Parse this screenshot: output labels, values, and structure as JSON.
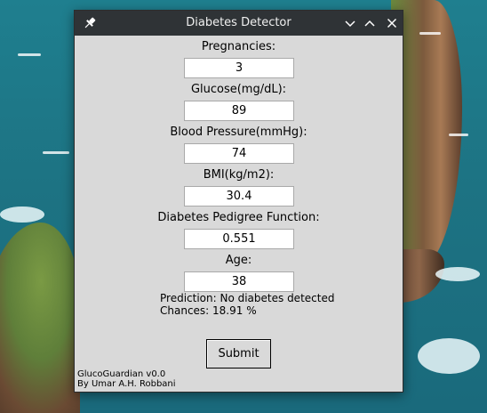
{
  "window": {
    "title": "Diabetes Detector",
    "controls": [
      "pin-icon",
      "chevron-down-icon",
      "chevron-up-icon",
      "close-icon"
    ]
  },
  "form": {
    "fields": [
      {
        "label": "Pregnancies:",
        "value": "3"
      },
      {
        "label": "Glucose(mg/dL):",
        "value": "89"
      },
      {
        "label": "Blood Pressure(mmHg):",
        "value": "74"
      },
      {
        "label": "BMI(kg/m2):",
        "value": "30.4"
      },
      {
        "label": "Diabetes Pedigree Function:",
        "value": "0.551"
      },
      {
        "label": "Age:",
        "value": "38"
      }
    ],
    "prediction_text": "Prediction: No diabetes detected",
    "chances_text": "Chances: 18.91 %",
    "submit_label": "Submit"
  },
  "footer": {
    "app_version": "GlucoGuardian v0.0",
    "author": "By Umar A.H. Robbani"
  },
  "colors": {
    "titlebar": "#2f3336",
    "window_bg": "#d9d9d9",
    "input_bg": "#ffffff"
  }
}
